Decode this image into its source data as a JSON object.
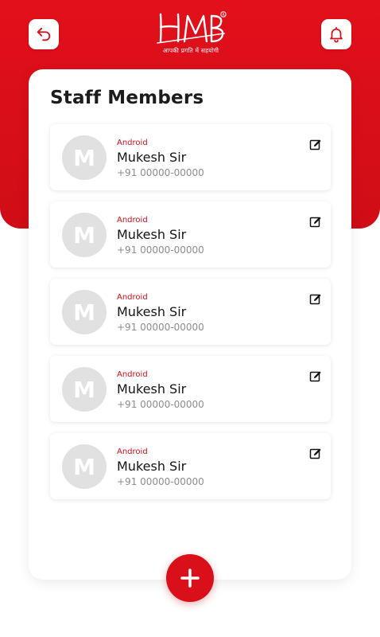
{
  "header": {
    "logo_tagline": "आपकी प्रगति में सहयोगी",
    "logo_text": "HMB",
    "back_icon": "back-arrow-icon",
    "bell_icon": "bell-icon"
  },
  "panel": {
    "title": "Staff Members"
  },
  "staff": [
    {
      "initial": "M",
      "tag": "Android",
      "name": "Mukesh Sir",
      "phone": "+91 00000-00000"
    },
    {
      "initial": "M",
      "tag": "Android",
      "name": "Mukesh Sir",
      "phone": "+91 00000-00000"
    },
    {
      "initial": "M",
      "tag": "Android",
      "name": "Mukesh Sir",
      "phone": "+91 00000-00000"
    },
    {
      "initial": "M",
      "tag": "Android",
      "name": "Mukesh Sir",
      "phone": "+91 00000-00000"
    },
    {
      "initial": "M",
      "tag": "Android",
      "name": "Mukesh Sir",
      "phone": "+91 00000-00000"
    }
  ],
  "fab": {
    "icon": "plus-icon"
  },
  "colors": {
    "brand_red": "#d90f19",
    "avatar_gray": "#e1e1e1",
    "text_muted": "#8d8d8d"
  }
}
